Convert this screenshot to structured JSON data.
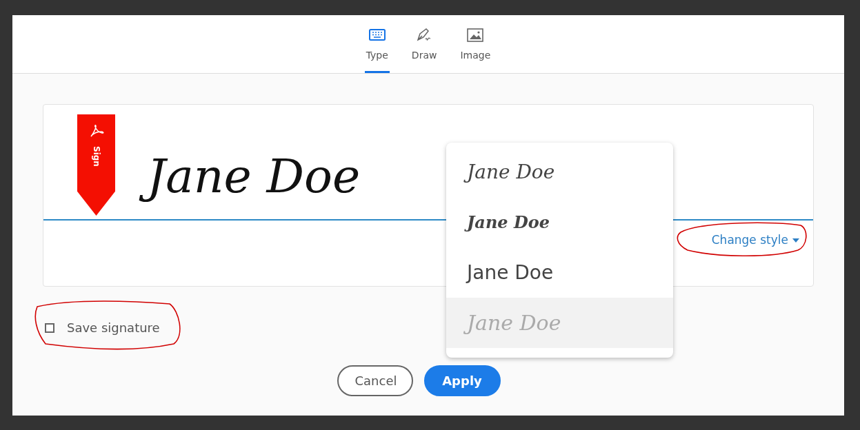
{
  "tabs": [
    {
      "label": "Type",
      "kind": "keyboard",
      "selected": true
    },
    {
      "label": "Draw",
      "kind": "pen",
      "selected": false
    },
    {
      "label": "Image",
      "kind": "picture",
      "selected": false
    }
  ],
  "signature": {
    "text": "Jane Doe",
    "ribbon_label": "Sign"
  },
  "change_style": {
    "label": "Change style",
    "expanded": true
  },
  "style_menu": [
    {
      "label": "Jane Doe",
      "selected": false
    },
    {
      "label": "Jane Doe",
      "selected": false
    },
    {
      "label": "Jane Doe",
      "selected": false
    },
    {
      "label": "Jane Doe",
      "selected": true
    }
  ],
  "save_signature": {
    "label": "Save signature",
    "checked": false
  },
  "buttons": [
    {
      "label": "Cancel",
      "kind": "secondary"
    },
    {
      "label": "Apply",
      "kind": "primary"
    }
  ]
}
